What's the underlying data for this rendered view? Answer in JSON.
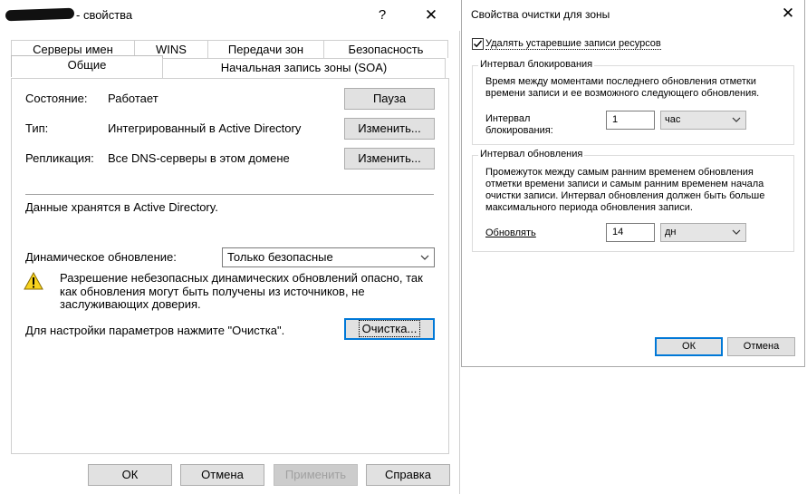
{
  "main_dialog": {
    "title_suffix": "- свойства",
    "help_glyph": "?",
    "close_glyph": "✕",
    "tabs_row1": [
      "Серверы имен",
      "WINS",
      "Передачи зон",
      "Безопасность"
    ],
    "tabs_row2": [
      "Общие",
      "Начальная запись зоны (SOA)"
    ],
    "active_tab": "Общие",
    "status": {
      "label": "Состояние:",
      "value": "Работает",
      "button": "Пауза"
    },
    "type": {
      "label": "Тип:",
      "value": "Интегрированный в Active Directory",
      "button": "Изменить..."
    },
    "replication": {
      "label": "Репликация:",
      "value": "Все DNS-серверы в этом домене",
      "button": "Изменить..."
    },
    "storage_note": "Данные хранятся в Active Directory.",
    "dynamic_update": {
      "label": "Динамическое обновление:",
      "selected": "Только безопасные"
    },
    "warning_text": "Разрешение небезопасных динамических обновлений опасно, так как обновления могут быть получены из источников, не заслуживающих доверия.",
    "aging": {
      "label": "Для настройки параметров нажмите \"Очистка\".",
      "button": "Очистка..."
    },
    "footer": {
      "ok": "ОК",
      "cancel": "Отмена",
      "apply": "Применить",
      "help": "Справка"
    }
  },
  "aging_dialog": {
    "title": "Свойства очистки для зоны",
    "close_glyph": "✕",
    "checkbox_label": "Удалять устаревшие записи ресурсов",
    "checkbox_checked": true,
    "no_refresh": {
      "group_title": "Интервал блокирования",
      "description": "Время между моментами последнего обновления отметки времени записи и ее возможного следующего обновления.",
      "field_label_line1": "Интервал",
      "field_label_line2": "блокирования:",
      "value": "1",
      "unit": "час"
    },
    "refresh": {
      "group_title": "Интервал обновления",
      "description": "Промежуток между самым ранним временем обновления отметки времени записи и самым ранним временем начала очистки записи. Интервал обновления должен быть больше максимального периода обновления записи.",
      "field_label": "Обновлять",
      "value": "14",
      "unit": "дн"
    },
    "footer": {
      "ok": "ОК",
      "cancel": "Отмена"
    }
  },
  "colors": {
    "focus_blue": "#0078d7",
    "button_face": "#e1e1e1",
    "warning_yellow": "#f7d21e"
  },
  "icons": [
    "help-icon",
    "close-icon",
    "warning-icon",
    "chevron-down-icon",
    "checkmark-icon"
  ]
}
